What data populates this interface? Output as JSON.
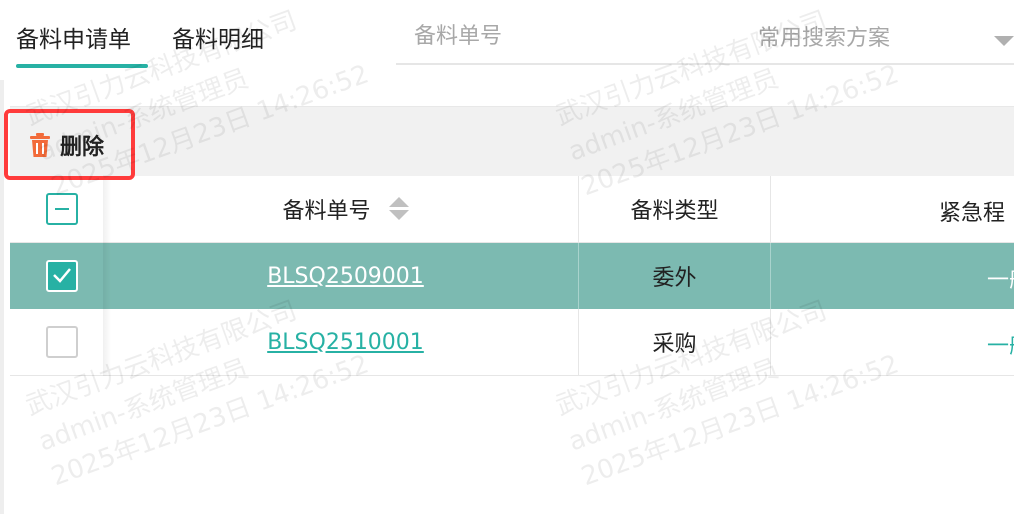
{
  "tabs": [
    {
      "label": "备料申请单",
      "active": true
    },
    {
      "label": "备料明细",
      "active": false
    }
  ],
  "search": {
    "placeholder": "备料单号",
    "value": ""
  },
  "scheme": {
    "placeholder": "常用搜索方案"
  },
  "toolbar": {
    "delete_label": "删除"
  },
  "table": {
    "headers": {
      "number": "备料单号",
      "type": "备料类型",
      "urgency": "紧急程"
    },
    "rows": [
      {
        "number": "BLSQ2509001",
        "type": "委外",
        "urgency": "一般",
        "checked": true
      },
      {
        "number": "BLSQ2510001",
        "type": "采购",
        "urgency": "一般",
        "checked": false
      }
    ]
  },
  "watermark": {
    "company": "武汉引力云科技有限公司",
    "user": "admin-系统管理员",
    "time": "2025年12月23日 14:26:52"
  },
  "colors": {
    "accent": "#27b1a4",
    "selected_row": "#7cbab1",
    "delete_icon": "#f26b3a",
    "highlight_box": "#ff3b3b"
  }
}
